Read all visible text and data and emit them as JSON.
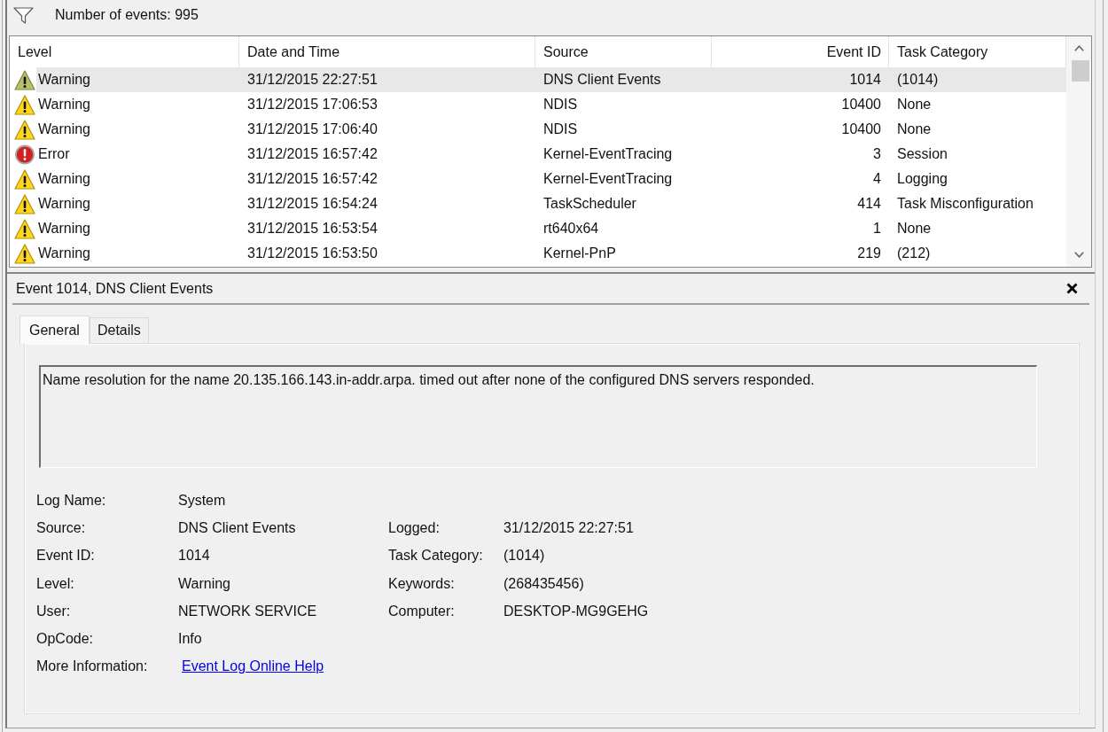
{
  "toolbar": {
    "event_count": "Number of events: 995"
  },
  "table": {
    "columns": [
      "Level",
      "Date and Time",
      "Source",
      "Event ID",
      "Task Category"
    ],
    "rows": [
      {
        "kind": "warning",
        "level": "Warning",
        "date_time": "31/12/2015 22:27:51",
        "source": "DNS Client Events",
        "event_id": "1014",
        "task_category": "(1014)",
        "selected": true
      },
      {
        "kind": "warning",
        "level": "Warning",
        "date_time": "31/12/2015 17:06:53",
        "source": "NDIS",
        "event_id": "10400",
        "task_category": "None",
        "selected": false
      },
      {
        "kind": "warning",
        "level": "Warning",
        "date_time": "31/12/2015 17:06:40",
        "source": "NDIS",
        "event_id": "10400",
        "task_category": "None",
        "selected": false
      },
      {
        "kind": "error",
        "level": "Error",
        "date_time": "31/12/2015 16:57:42",
        "source": "Kernel-EventTracing",
        "event_id": "3",
        "task_category": "Session",
        "selected": false
      },
      {
        "kind": "warning",
        "level": "Warning",
        "date_time": "31/12/2015 16:57:42",
        "source": "Kernel-EventTracing",
        "event_id": "4",
        "task_category": "Logging",
        "selected": false
      },
      {
        "kind": "warning",
        "level": "Warning",
        "date_time": "31/12/2015 16:54:24",
        "source": "TaskScheduler",
        "event_id": "414",
        "task_category": "Task Misconfiguration",
        "selected": false
      },
      {
        "kind": "warning",
        "level": "Warning",
        "date_time": "31/12/2015 16:53:54",
        "source": "rt640x64",
        "event_id": "1",
        "task_category": "None",
        "selected": false
      },
      {
        "kind": "warning",
        "level": "Warning",
        "date_time": "31/12/2015 16:53:50",
        "source": "Kernel-PnP",
        "event_id": "219",
        "task_category": "(212)",
        "selected": false
      }
    ]
  },
  "details": {
    "title": "Event 1014, DNS Client Events",
    "tabs": [
      {
        "label": "General",
        "selected": true
      },
      {
        "label": "Details",
        "selected": false
      }
    ],
    "message": "Name resolution for the name 20.135.166.143.in-addr.arpa. timed out after none of the configured DNS servers responded.",
    "properties": [
      {
        "cells": [
          {
            "label": "Log Name:",
            "value": "System",
            "kind": "text"
          }
        ]
      },
      {
        "cells": [
          {
            "label": "Source:",
            "value": "DNS Client Events",
            "kind": "text"
          },
          {
            "label": "Logged:",
            "value": "31/12/2015 22:27:51",
            "kind": "text"
          }
        ]
      },
      {
        "cells": [
          {
            "label": "Event ID:",
            "value": "1014",
            "kind": "text"
          },
          {
            "label": "Task Category:",
            "value": "(1014)",
            "kind": "text"
          }
        ]
      },
      {
        "cells": [
          {
            "label": "Level:",
            "value": "Warning",
            "kind": "text"
          },
          {
            "label": "Keywords:",
            "value": "(268435456)",
            "kind": "text"
          }
        ]
      },
      {
        "cells": [
          {
            "label": "User:",
            "value": "NETWORK SERVICE",
            "kind": "text"
          },
          {
            "label": "Computer:",
            "value": "DESKTOP-MG9GEHG",
            "kind": "text"
          }
        ]
      },
      {
        "cells": [
          {
            "label": "OpCode:",
            "value": "Info",
            "kind": "text"
          }
        ]
      },
      {
        "cells": [
          {
            "label": "More Information:",
            "value": "Event Log Online Help",
            "kind": "link"
          }
        ]
      }
    ]
  }
}
